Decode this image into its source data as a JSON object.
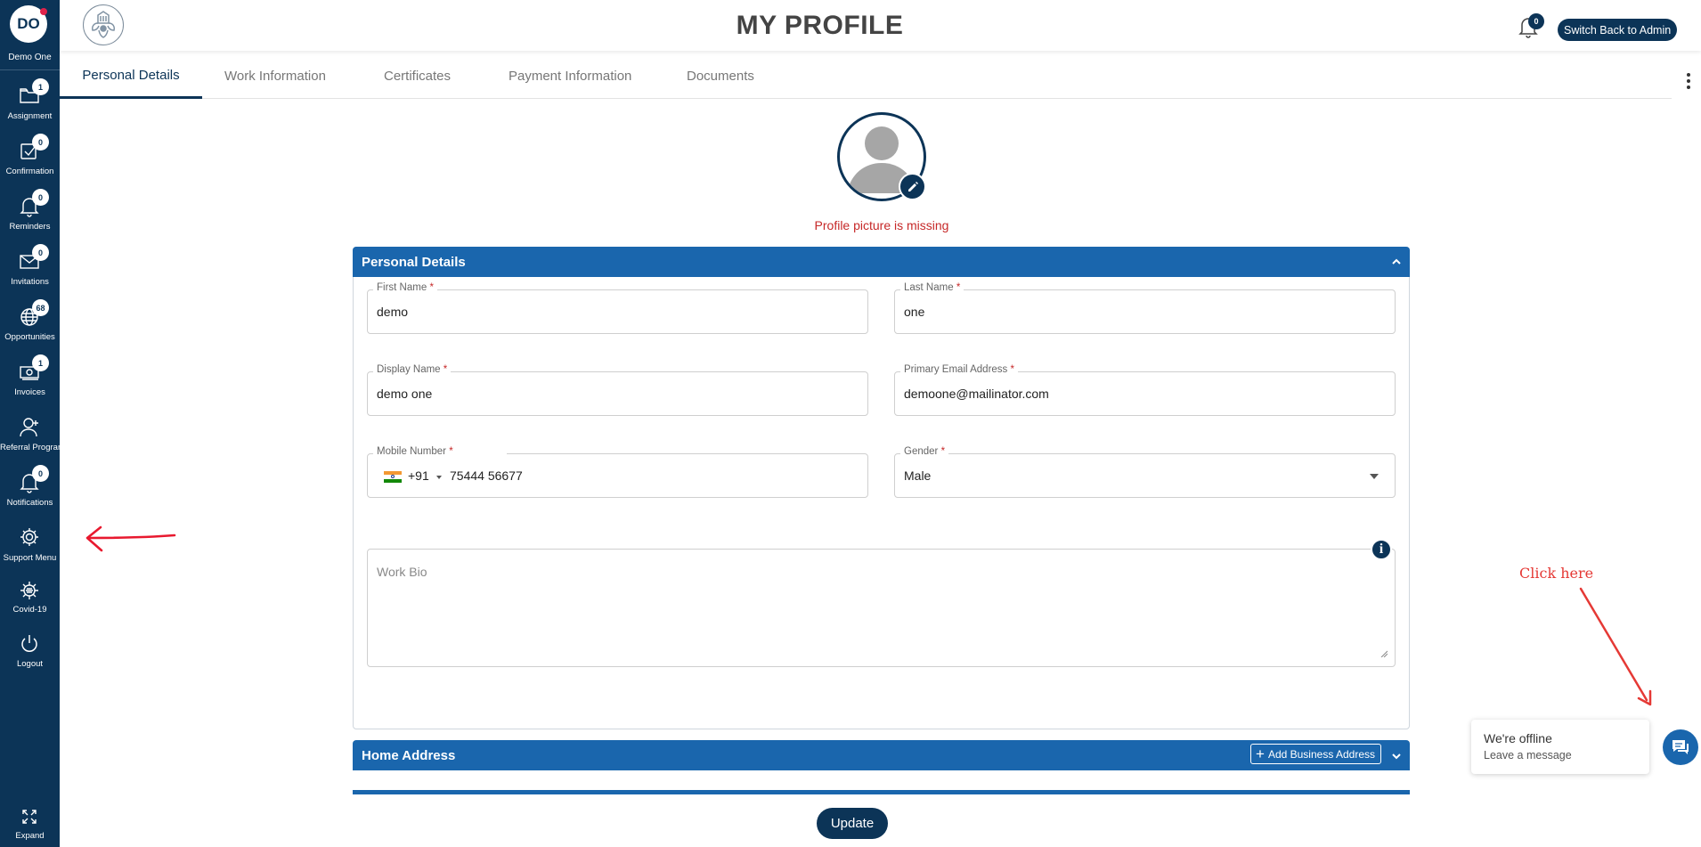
{
  "user": {
    "initials": "DO",
    "name": "Demo One"
  },
  "sidebar": {
    "items": [
      {
        "label": "Assignment",
        "badge": "1",
        "icon": "folder-icon"
      },
      {
        "label": "Confirmation",
        "badge": "0",
        "icon": "check-square-icon"
      },
      {
        "label": "Reminders",
        "badge": "0",
        "icon": "bell-icon"
      },
      {
        "label": "Invitations",
        "badge": "0",
        "icon": "envelope-icon"
      },
      {
        "label": "Opportunities",
        "badge": "68",
        "icon": "globe-icon"
      },
      {
        "label": "Invoices",
        "badge": "1",
        "icon": "money-icon"
      },
      {
        "label": "Referral Program",
        "badge": "",
        "icon": "user-add-icon"
      },
      {
        "label": "Notifications",
        "badge": "0",
        "icon": "bell-icon"
      },
      {
        "label": "Support Menu",
        "badge": "",
        "icon": "gear-icon"
      },
      {
        "label": "Covid-19",
        "badge": "",
        "icon": "virus-icon"
      },
      {
        "label": "Logout",
        "badge": "",
        "icon": "power-icon"
      }
    ],
    "expand_label": "Expand"
  },
  "header": {
    "title": "MY PROFILE",
    "notification_count": "0",
    "switch_label": "Switch Back to Admin"
  },
  "tabs": [
    "Personal Details",
    "Work Information",
    "Certificates",
    "Payment Information",
    "Documents"
  ],
  "active_tab": "Personal Details",
  "profile": {
    "picture_warning": "Profile picture is missing"
  },
  "personal": {
    "section_title": "Personal Details",
    "first_name_label": "First Name",
    "first_name": "demo",
    "last_name_label": "Last Name",
    "last_name": "one",
    "display_name_label": "Display Name",
    "display_name": "demo one",
    "email_label": "Primary Email Address",
    "email": "demoone@mailinator.com",
    "mobile_label": "Mobile Number",
    "country_code": "+91",
    "mobile": "75444 56677",
    "gender_label": "Gender",
    "gender": "Male",
    "bio_placeholder": "Work Bio",
    "required_mark": "*"
  },
  "home_address": {
    "section_title": "Home Address",
    "add_business_label": "Add Business Address"
  },
  "update_label": "Update",
  "chat": {
    "title": "We're offline",
    "subtitle": "Leave a message"
  },
  "annotation": {
    "text": "Click here"
  },
  "colors": {
    "sidebar": "#0c3457",
    "section": "#1a66ad",
    "error": "#c62828",
    "annotation": "#e53935"
  }
}
